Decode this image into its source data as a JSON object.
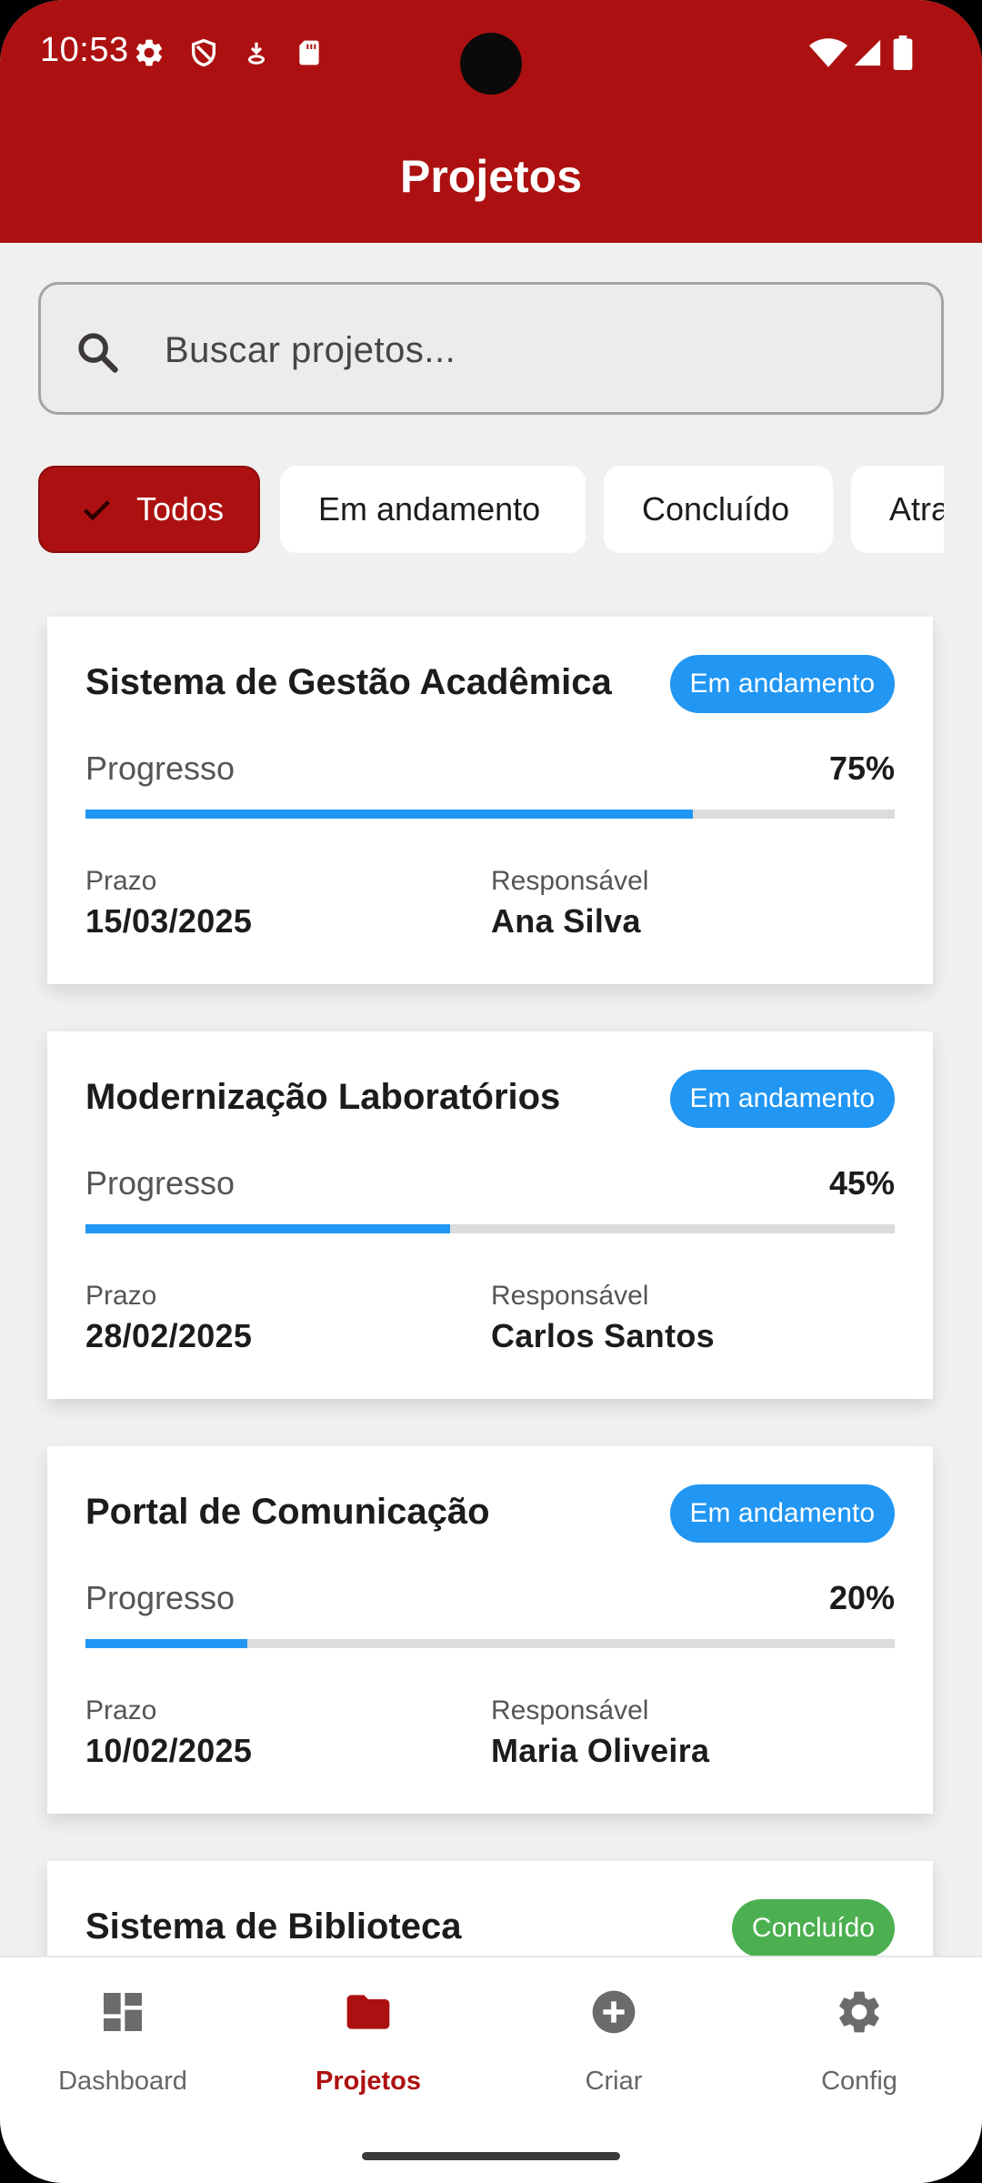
{
  "status_bar": {
    "time": "10:53"
  },
  "header": {
    "title": "Projetos"
  },
  "search": {
    "placeholder": "Buscar projetos..."
  },
  "filters": [
    {
      "label": "Todos",
      "selected": true
    },
    {
      "label": "Em andamento",
      "selected": false
    },
    {
      "label": "Concluído",
      "selected": false
    },
    {
      "label": "Atrasado",
      "selected": false
    }
  ],
  "labels": {
    "progress": "Progresso",
    "deadline": "Prazo",
    "owner": "Responsável"
  },
  "projects": [
    {
      "title": "Sistema de Gestão Acadêmica",
      "status": "Em andamento",
      "status_color": "#2196f3",
      "progress": 75,
      "progress_label": "75%",
      "deadline": "15/03/2025",
      "owner": "Ana Silva"
    },
    {
      "title": "Modernização Laboratórios",
      "status": "Em andamento",
      "status_color": "#2196f3",
      "progress": 45,
      "progress_label": "45%",
      "deadline": "28/02/2025",
      "owner": "Carlos Santos"
    },
    {
      "title": "Portal de Comunicação",
      "status": "Em andamento",
      "status_color": "#2196f3",
      "progress": 20,
      "progress_label": "20%",
      "deadline": "10/02/2025",
      "owner": "Maria Oliveira"
    },
    {
      "title": "Sistema de Biblioteca",
      "status": "Concluído",
      "status_color": "#4caf50"
    }
  ],
  "bottom_nav": [
    {
      "label": "Dashboard",
      "icon": "dashboard-icon",
      "active": false
    },
    {
      "label": "Projetos",
      "icon": "folder-icon",
      "active": true
    },
    {
      "label": "Criar",
      "icon": "add-circle-icon",
      "active": false
    },
    {
      "label": "Config",
      "icon": "gear-icon",
      "active": false
    }
  ],
  "colors": {
    "primary": "#ad1010",
    "progress": "#2196f3",
    "done": "#4caf50"
  }
}
